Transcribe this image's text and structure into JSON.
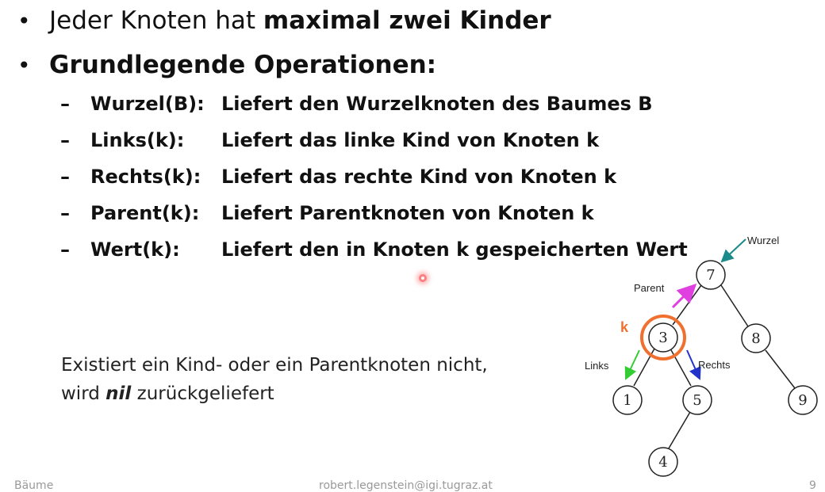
{
  "bullets": [
    {
      "prefix": "Jeder Knoten hat ",
      "bold": "maximal zwei Kinder"
    },
    {
      "bold": "Grundlegende Operationen:"
    }
  ],
  "operations": [
    {
      "name": "Wurzel(B):",
      "desc": "Liefert den Wurzelknoten des Baumes B"
    },
    {
      "name": "Links(k):",
      "desc": "Liefert das linke Kind von Knoten k"
    },
    {
      "name": "Rechts(k):",
      "desc": "Liefert das rechte Kind von Knoten k"
    },
    {
      "name": "Parent(k):",
      "desc": "Liefert Parentknoten von Knoten k"
    },
    {
      "name": "Wert(k):",
      "desc": "Liefert den in Knoten k gespeicherten Wert"
    }
  ],
  "note": {
    "line1": "Existiert ein Kind- oder ein Parentknoten nicht,",
    "line2_before": "wird ",
    "line2_emph": "nil",
    "line2_after": " zurückgeliefert"
  },
  "tree": {
    "nodes": {
      "n7": "7",
      "n3": "3",
      "n8": "8",
      "n1": "1",
      "n5": "5",
      "n9": "9",
      "n4": "4"
    },
    "labels": {
      "wurzel": "Wurzel",
      "parent": "Parent",
      "k": "k",
      "links": "Links",
      "rechts": "Rechts"
    },
    "colors": {
      "highlight": "#f07030",
      "links_arrow": "#33cc33",
      "rechts_arrow": "#2233cc",
      "parent_arrow": "#e040e0",
      "wurzel_arrow": "#1a8a8a"
    }
  },
  "footer": {
    "left": "Bäume",
    "center": "robert.legenstein@igi.tugraz.at",
    "right": "9"
  }
}
